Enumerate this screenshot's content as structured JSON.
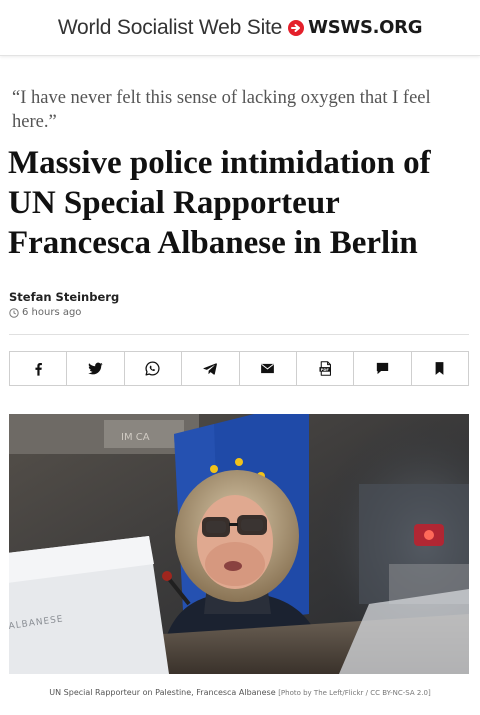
{
  "header": {
    "site_name": "World Socialist Web Site",
    "site_domain": "WSWS.ORG",
    "logo_icon": "red-circle-arrow-icon",
    "brand_color": "#e4202b"
  },
  "article": {
    "kicker": "“I have never felt this sense of lacking oxygen that I feel here.”",
    "headline": "Massive police intimidation of UN Special Rapporteur Francesca Albanese in Berlin",
    "author": "Stefan Steinberg",
    "time_ago": "6 hours ago"
  },
  "share_bar": {
    "buttons": [
      {
        "icon": "facebook-icon"
      },
      {
        "icon": "twitter-icon"
      },
      {
        "icon": "whatsapp-icon"
      },
      {
        "icon": "telegram-icon"
      },
      {
        "icon": "email-icon"
      },
      {
        "icon": "pdf-icon"
      },
      {
        "icon": "comment-icon"
      },
      {
        "icon": "bookmark-icon"
      }
    ]
  },
  "photo": {
    "placard_text": "ALBANESE",
    "caption": "UN Special Rapporteur on Palestine, Francesca Albanese",
    "credit": "[Photo by The Left/Flickr / CC BY-NC-SA 2.0]"
  }
}
